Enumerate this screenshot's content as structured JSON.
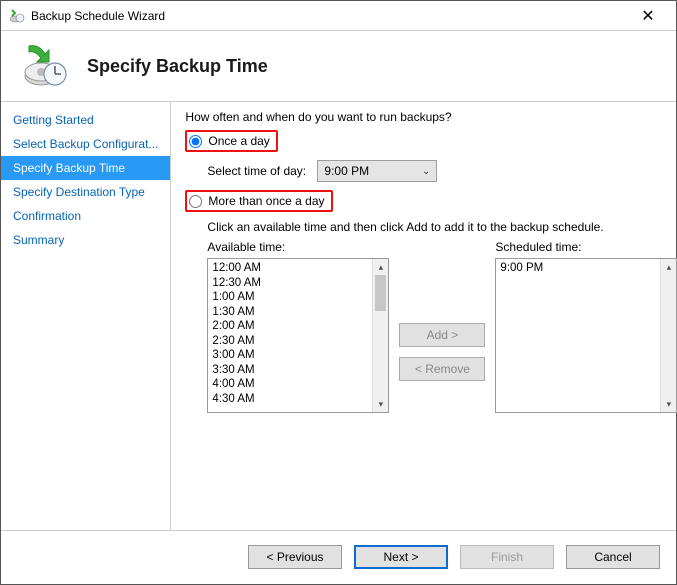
{
  "window": {
    "title": "Backup Schedule Wizard"
  },
  "header": {
    "title": "Specify Backup Time"
  },
  "sidebar": {
    "items": [
      {
        "label": "Getting Started",
        "selected": false
      },
      {
        "label": "Select Backup Configurat...",
        "selected": false
      },
      {
        "label": "Specify Backup Time",
        "selected": true
      },
      {
        "label": "Specify Destination Type",
        "selected": false
      },
      {
        "label": "Confirmation",
        "selected": false
      },
      {
        "label": "Summary",
        "selected": false
      }
    ]
  },
  "content": {
    "prompt": "How often and when do you want to run backups?",
    "radio_once": "Once a day",
    "selecttime_label": "Select time of day:",
    "selecttime_value": "9:00 PM",
    "radio_more": "More than once a day",
    "more_desc": "Click an available time and then click Add to add it to the backup schedule.",
    "available_label": "Available time:",
    "scheduled_label": "Scheduled time:",
    "available_times": [
      "12:00 AM",
      "12:30 AM",
      "1:00 AM",
      "1:30 AM",
      "2:00 AM",
      "2:30 AM",
      "3:00 AM",
      "3:30 AM",
      "4:00 AM",
      "4:30 AM"
    ],
    "scheduled_times": [
      "9:00 PM"
    ],
    "add_label": "Add >",
    "remove_label": "< Remove"
  },
  "footer": {
    "previous": "< Previous",
    "next": "Next >",
    "finish": "Finish",
    "cancel": "Cancel"
  }
}
